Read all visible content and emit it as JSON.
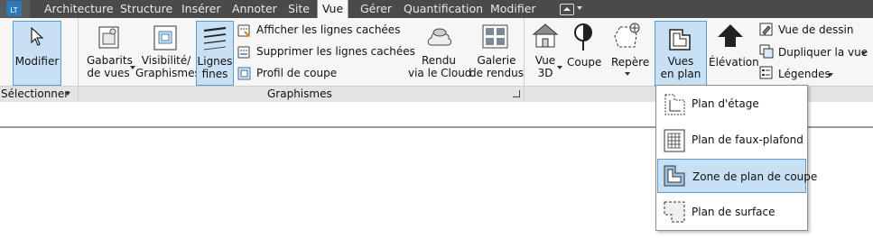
{
  "tabs": {
    "app_badge": "LT",
    "items": [
      "Architecture",
      "Structure",
      "Insérer",
      "Annoter",
      "Site",
      "Vue",
      "Gérer",
      "Quantification",
      "Modifier"
    ],
    "active": "Vue"
  },
  "ribbon": {
    "select_panel": {
      "modify": "Modifier",
      "panel_label": "Sélectionner"
    },
    "graphics_panel": {
      "view_templates_line1": "Gabarits",
      "view_templates_line2": "de vues",
      "visibility_line1": "Visibilité/",
      "visibility_line2": "Graphismes",
      "thin_lines_line1": "Lignes",
      "thin_lines_line2": "fines",
      "show_hidden": "Afficher les lignes cachées",
      "remove_hidden": "Supprimer les lignes cachées",
      "cut_profile": "Profil de coupe",
      "panel_label": "Graphismes"
    },
    "presentation": {
      "render_cloud_line1": "Rendu",
      "render_cloud_line2": "via le Cloud",
      "render_gallery_line1": "Galerie",
      "render_gallery_line2": "de rendus"
    },
    "create": {
      "view3d_line1": "Vue",
      "view3d_line2": "3D",
      "section": "Coupe",
      "callout": "Repère",
      "plan_views_line1": "Vues",
      "plan_views_line2": "en plan",
      "elevation": "Élévation",
      "drafting_view": "Vue de dessin",
      "duplicate_view": "Dupliquer la vue",
      "legends": "Légendes"
    }
  },
  "menu": {
    "items": [
      {
        "label": "Plan d'étage",
        "icon": "floor-plan-icon"
      },
      {
        "label": "Plan de faux-plafond",
        "icon": "ceiling-plan-icon"
      },
      {
        "label": "Zone de plan de coupe",
        "icon": "plan-region-icon"
      },
      {
        "label": "Plan de surface",
        "icon": "area-plan-icon"
      }
    ],
    "highlighted_index": 2
  },
  "colors": {
    "accent": "#c7e0f4",
    "accent_border": "#5d9bd0",
    "tabbar": "#4a4a4a"
  }
}
